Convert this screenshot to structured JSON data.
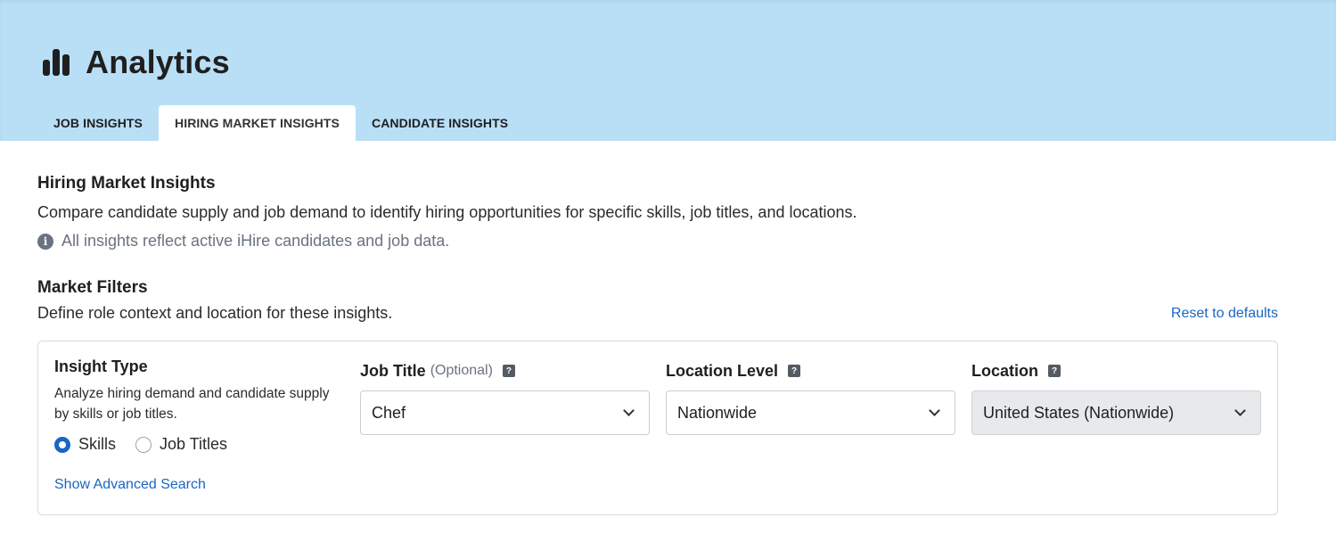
{
  "header": {
    "title": "Analytics",
    "icon": "bar-chart-icon",
    "background": "#b9dff7",
    "tabs": [
      {
        "label": "JOB INSIGHTS",
        "active": false
      },
      {
        "label": "HIRING MARKET INSIGHTS",
        "active": true
      },
      {
        "label": "CANDIDATE INSIGHTS",
        "active": false
      }
    ]
  },
  "intro": {
    "title": "Hiring Market Insights",
    "description": "Compare candidate supply and job demand to identify hiring opportunities for specific skills, job titles, and locations.",
    "note": "All insights reflect active iHire candidates and job data.",
    "note_icon": "info-icon"
  },
  "filters": {
    "title": "Market Filters",
    "description": "Define role context and location for these insights.",
    "reset_label": "Reset to defaults",
    "insight_type": {
      "label": "Insight Type",
      "help": "Analyze hiring demand and candidate supply by skills or job titles.",
      "options": [
        {
          "label": "Skills",
          "checked": true
        },
        {
          "label": "Job Titles",
          "checked": false
        }
      ]
    },
    "advanced_label": "Show Advanced Search",
    "job_title": {
      "label": "Job Title",
      "optional": "(Optional)",
      "value": "Chef"
    },
    "location_level": {
      "label": "Location Level",
      "value": "Nationwide"
    },
    "location": {
      "label": "Location",
      "value": "United States (Nationwide)",
      "disabled": true
    }
  },
  "colors": {
    "accent": "#1a66c2",
    "muted_text": "#6b7280"
  }
}
